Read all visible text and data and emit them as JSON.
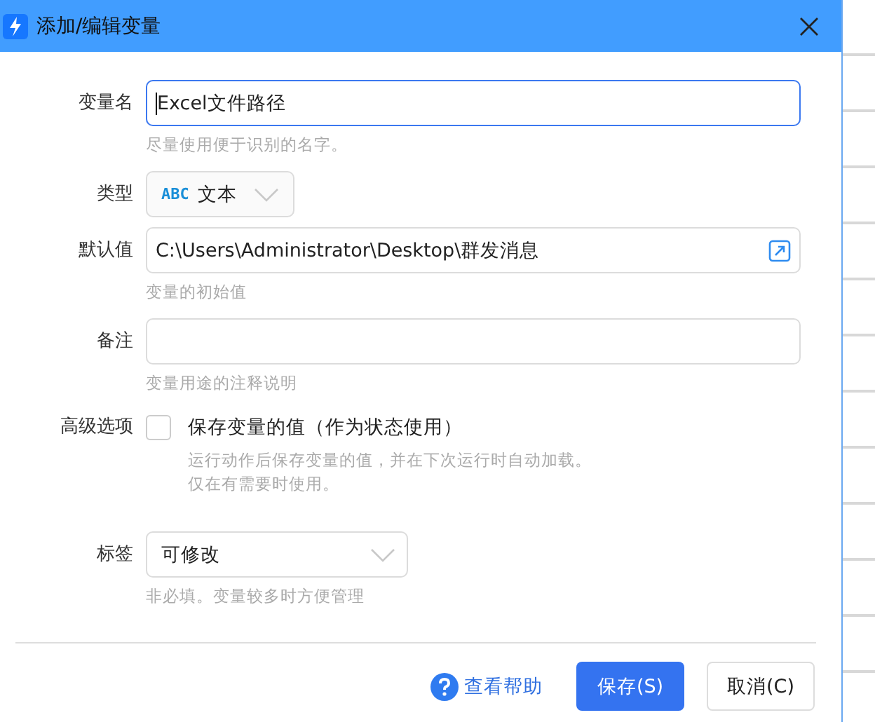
{
  "window": {
    "title": "添加/编辑变量"
  },
  "fields": [
    {
      "kind": "text",
      "label": "变量名",
      "value": "Excel文件路径",
      "focused": true,
      "hint": "尽量使用便于识别的名字。"
    },
    {
      "kind": "type-select",
      "label": "类型",
      "badge": "ABC",
      "value": "文本"
    },
    {
      "kind": "path",
      "label": "默认值",
      "value": "C:\\Users\\Administrator\\Desktop\\群发消息",
      "hint": "变量的初始值"
    },
    {
      "kind": "text",
      "label": "备注",
      "focused": false,
      "hint": "变量用途的注释说明"
    },
    {
      "kind": "checkbox",
      "label": "高级选项",
      "text": "保存变量的值（作为状态使用）",
      "checked": false,
      "hint_lines": [
        "运行动作后保存变量的值，并在下次运行时自动加载。",
        "仅在有需要时使用。"
      ]
    },
    {
      "kind": "select",
      "label": "标签",
      "value": "可修改",
      "hint": "非必填。变量较多时方便管理"
    }
  ],
  "footer": {
    "help": "查看帮助",
    "buttons": [
      {
        "label": "保存(S)",
        "kind": "primary"
      },
      {
        "label": "取消(C)",
        "kind": "secondary"
      }
    ]
  }
}
